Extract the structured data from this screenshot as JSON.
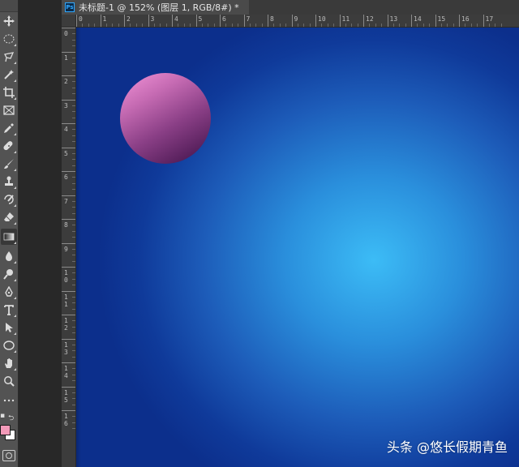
{
  "document": {
    "tab_title": "未标题-1 @ 152% (图层 1, RGB/8#) *",
    "app_badge": "Ps"
  },
  "rulers": {
    "horizontal": [
      "0",
      "1",
      "2",
      "3",
      "4",
      "5",
      "6",
      "7",
      "8",
      "9",
      "10",
      "11",
      "12",
      "13",
      "14",
      "15",
      "16",
      "17"
    ],
    "vertical": [
      "0",
      "1",
      "2",
      "3",
      "4",
      "5",
      "6",
      "7",
      "8",
      "9",
      "10",
      "11",
      "12",
      "13",
      "14",
      "15",
      "16"
    ]
  },
  "toolbar": {
    "tools": [
      "move-icon",
      "marquee-ellipse-icon",
      "lasso-icon",
      "magic-wand-icon",
      "crop-icon",
      "frame-icon",
      "eyedropper-icon",
      "healing-brush-icon",
      "brush-icon",
      "clone-stamp-icon",
      "history-brush-icon",
      "eraser-icon",
      "gradient-icon",
      "blur-icon",
      "dodge-icon",
      "pen-icon",
      "type-icon",
      "path-selection-icon",
      "ellipse-shape-icon",
      "hand-icon",
      "zoom-icon",
      "more-tools-icon"
    ],
    "active_tool": "gradient-icon",
    "foreground_color": "#f39ab9",
    "background_color": "#ffffff"
  },
  "canvas": {
    "center_color": "#3cbcf6",
    "edge_color": "#0c2f8c",
    "sphere_highlight": "#f294d8",
    "sphere_shadow": "#3d1047"
  },
  "watermark": "头条 @悠长假期青鱼"
}
